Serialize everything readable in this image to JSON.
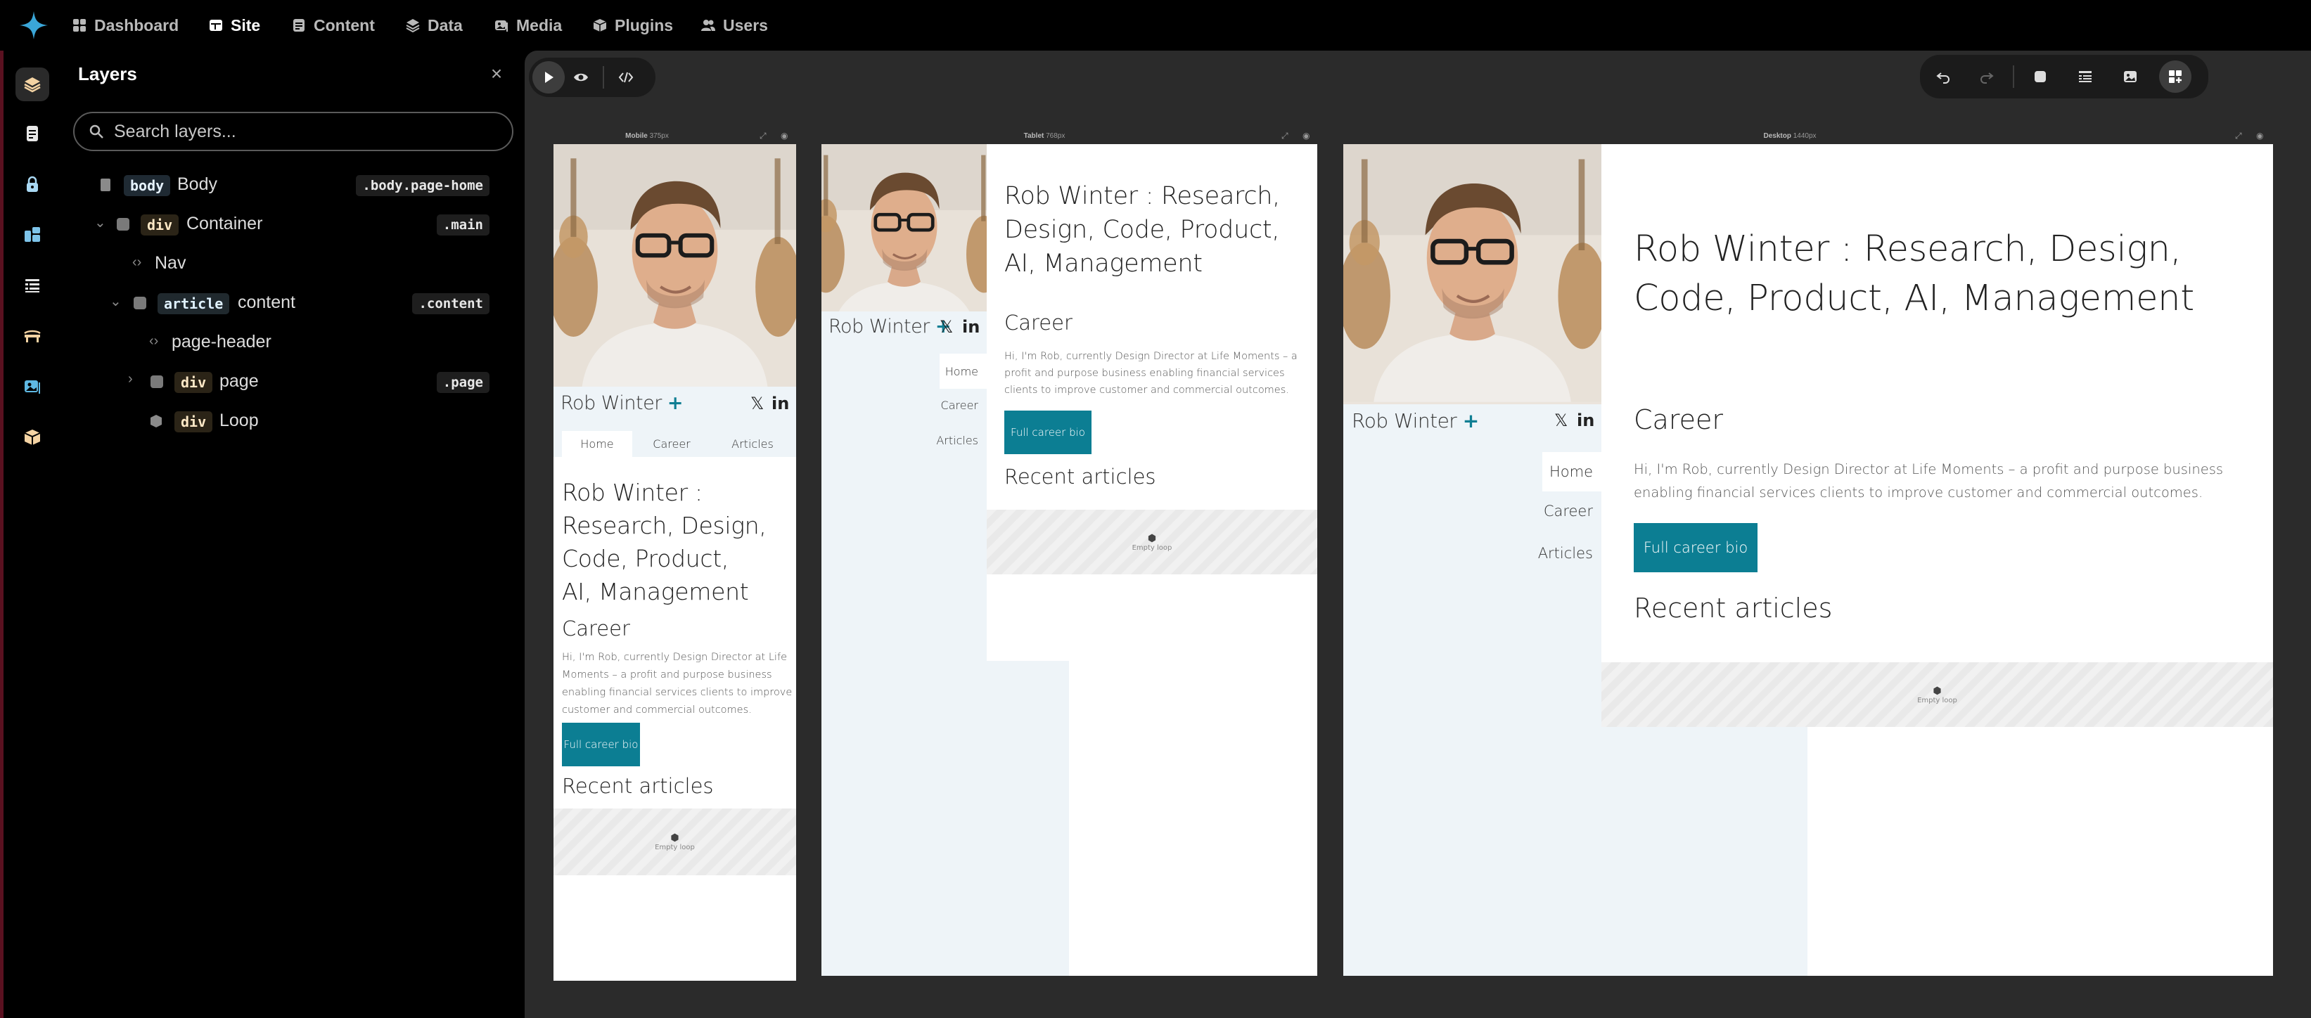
{
  "topnav": {
    "items": [
      {
        "label": "Dashboard",
        "icon": "dashboard-icon"
      },
      {
        "label": "Site",
        "icon": "site-icon",
        "active": true
      },
      {
        "label": "Content",
        "icon": "content-icon"
      },
      {
        "label": "Data",
        "icon": "data-icon"
      },
      {
        "label": "Media",
        "icon": "media-icon"
      },
      {
        "label": "Plugins",
        "icon": "plugins-icon"
      },
      {
        "label": "Users",
        "icon": "users-icon"
      }
    ]
  },
  "rail": {
    "icons": [
      "layers-icon",
      "pages-icon",
      "lock-icon",
      "components-icon",
      "list-icon",
      "bridge-icon",
      "images-icon",
      "package-icon"
    ],
    "active": "layers-icon"
  },
  "layers": {
    "title": "Layers",
    "close_glyph": "×",
    "search_placeholder": "Search layers...",
    "items": [
      {
        "tag": "body",
        "name": "Body",
        "class": ".body.page-home"
      },
      {
        "tag": "div",
        "name": "Container",
        "class": ".main"
      },
      {
        "tag": "",
        "name": "Nav",
        "class": ""
      },
      {
        "tag": "article",
        "name": "content",
        "class": ".content"
      },
      {
        "tag": "",
        "name": "page-header",
        "class": ""
      },
      {
        "tag": "div",
        "name": "page",
        "class": ".page"
      },
      {
        "tag": "div",
        "name": "Loop",
        "class": ""
      }
    ]
  },
  "canvas": {
    "frames": {
      "mobile": {
        "label": "Mobile",
        "size": "375px"
      },
      "tablet": {
        "label": "Tablet",
        "size": "768px"
      },
      "desktop": {
        "label": "Desktop",
        "size": "1440px"
      }
    }
  },
  "site": {
    "name": "Rob Winter",
    "plus": "+",
    "x_glyph": "𝕏",
    "linkedin_glyph": "in",
    "nav": [
      "Home",
      "Career",
      "Articles"
    ],
    "hero_lines_mobile": [
      "Rob Winter :",
      "Research, Design,",
      "Code, Product,",
      "AI, Management"
    ],
    "hero_lines_tablet": [
      "Rob Winter : Research,",
      "Design, Code, Product,",
      "AI, Management"
    ],
    "hero_lines_desktop": [
      "Rob Winter : Research, Design,",
      "Code, Product, AI, Management"
    ],
    "career_heading": "Career",
    "bio_mobile": [
      "Hi, I'm Rob, currently Design Director at Life",
      "Moments – a profit and purpose business",
      "enabling financial services clients to improve",
      "customer and commercial outcomes."
    ],
    "bio_tablet": [
      "Hi, I'm Rob, currently Design Director at Life Moments – a",
      "profit and purpose business enabling financial services",
      "clients to improve customer and commercial outcomes."
    ],
    "bio_desktop": [
      "Hi, I'm Rob, currently Design Director at Life Moments – a profit and purpose business",
      "enabling financial services clients to improve customer and commercial outcomes."
    ],
    "button_label": "Full career bio",
    "recent_heading": "Recent articles",
    "empty_loop": "Empty loop"
  },
  "colors": {
    "accent": "#0c7e93",
    "logo": "#3aa6d8"
  }
}
